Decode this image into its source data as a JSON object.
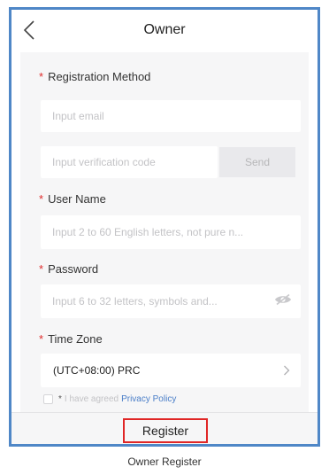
{
  "header": {
    "title": "Owner",
    "back_icon": "chevron-left-icon"
  },
  "form": {
    "registration_method": {
      "required_mark": "*",
      "label": "Registration Method",
      "email_placeholder": "Input email",
      "code_placeholder": "Input verification code",
      "send_label": "Send"
    },
    "user_name": {
      "required_mark": "*",
      "label": "User Name",
      "placeholder": "Input 2 to 60 English letters, not pure n..."
    },
    "password": {
      "required_mark": "*",
      "label": "Password",
      "placeholder": "Input 6 to 32 letters, symbols and...",
      "visibility_icon": "eye-icon"
    },
    "time_zone": {
      "required_mark": "*",
      "label": "Time Zone",
      "value": "(UTC+08:00) PRC",
      "chevron_icon": "chevron-right-icon"
    },
    "agreement": {
      "checked": false,
      "required_mark": "*",
      "text": "I have agreed",
      "link": "Privacy Policy"
    }
  },
  "footer": {
    "register_label": "Register"
  },
  "caption": "Owner Register",
  "colors": {
    "frame_border": "#4f87c7",
    "required": "#e02c2c",
    "link": "#4a7ec8",
    "highlight_box": "#e02626"
  }
}
